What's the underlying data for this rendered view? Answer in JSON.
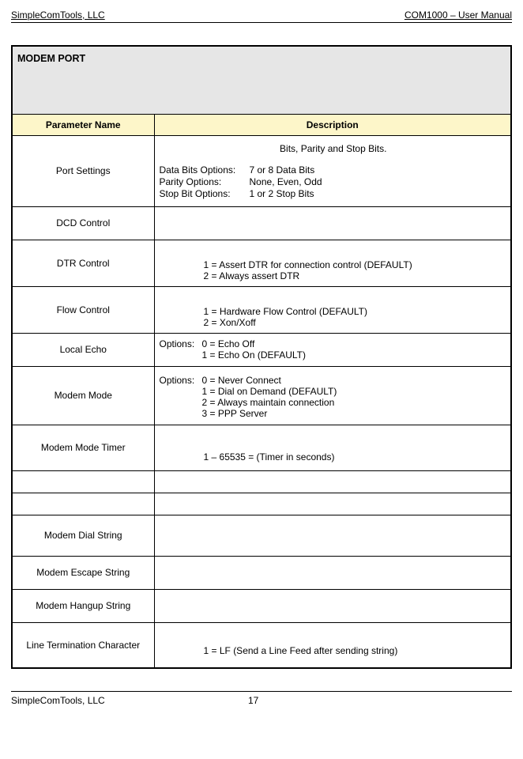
{
  "header": {
    "left": "SimpleComTools, LLC",
    "right": "COM1000 – User Manual"
  },
  "table": {
    "section_title": "MODEM PORT",
    "col1": "Parameter Name",
    "col2": "Description",
    "rows": {
      "port_settings": {
        "name": "Port Settings",
        "top_line": "Bits, Parity and Stop Bits.",
        "opt1_label": "Data Bits Options:",
        "opt1_value": "7 or 8 Data Bits",
        "opt2_label": "Parity Options:",
        "opt2_value": "None, Even, Odd",
        "opt3_label": "Stop Bit Options:",
        "opt3_value": "1 or 2 Stop Bits"
      },
      "dcd_control": {
        "name": "DCD Control",
        "desc": ""
      },
      "dtr_control": {
        "name": "DTR Control",
        "line1": "1 = Assert DTR for connection control (DEFAULT)",
        "line2": "2 = Always assert DTR"
      },
      "flow_control": {
        "name": "Flow Control",
        "line1": "1 = Hardware Flow Control (DEFAULT)",
        "line2": "2 = Xon/Xoff"
      },
      "local_echo": {
        "name": "Local Echo",
        "label": "Options:",
        "line1": "0 = Echo Off",
        "line2": "1 = Echo On (DEFAULT)"
      },
      "modem_mode": {
        "name": "Modem Mode",
        "label": "Options:",
        "line1": "0 = Never Connect",
        "line2": "1 = Dial on Demand (DEFAULT)",
        "line3": "2 = Always maintain connection",
        "line4": "3 = PPP Server"
      },
      "modem_mode_timer": {
        "name": "Modem Mode Timer",
        "line1": "1 – 65535 = (Timer in seconds)"
      },
      "empty1": {
        "name": "",
        "desc": ""
      },
      "empty2": {
        "name": "",
        "desc": ""
      },
      "modem_dial_string": {
        "name": "Modem Dial String",
        "desc": ""
      },
      "modem_escape_string": {
        "name": "Modem Escape String",
        "desc": ""
      },
      "modem_hangup_string": {
        "name": "Modem Hangup String",
        "desc": ""
      },
      "line_termination": {
        "name": "Line Termination Character",
        "line1": "1 = LF (Send a Line Feed after sending string)"
      }
    }
  },
  "footer": {
    "company": "SimpleComTools, LLC",
    "page": "17"
  }
}
